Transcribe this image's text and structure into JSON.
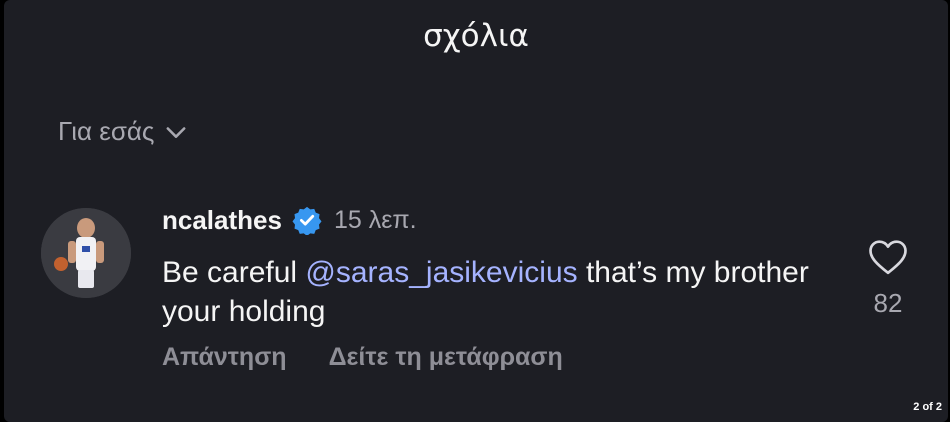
{
  "header": {
    "title": "σχόλια"
  },
  "filter": {
    "label": "Για εσάς",
    "icon": "chevron-down-icon"
  },
  "comment": {
    "username": "ncalathes",
    "verified_icon": "verified-badge-icon",
    "time": "15 λεπ.",
    "text_before": "Be careful ",
    "mention": "@saras_jasikevicius",
    "text_after": " that’s my brother your holding",
    "reply_label": "Απάντηση",
    "translate_label": "Δείτε τη μετάφραση",
    "like_icon": "heart-icon",
    "like_count": "82"
  },
  "page_indicator": "2 of 2",
  "colors": {
    "background": "#000000",
    "sheet": "#1d1e24",
    "text_primary": "#f5f5f5",
    "text_secondary": "#a8a8b0",
    "mention": "#a5b3ff",
    "verified": "#3797f0"
  }
}
